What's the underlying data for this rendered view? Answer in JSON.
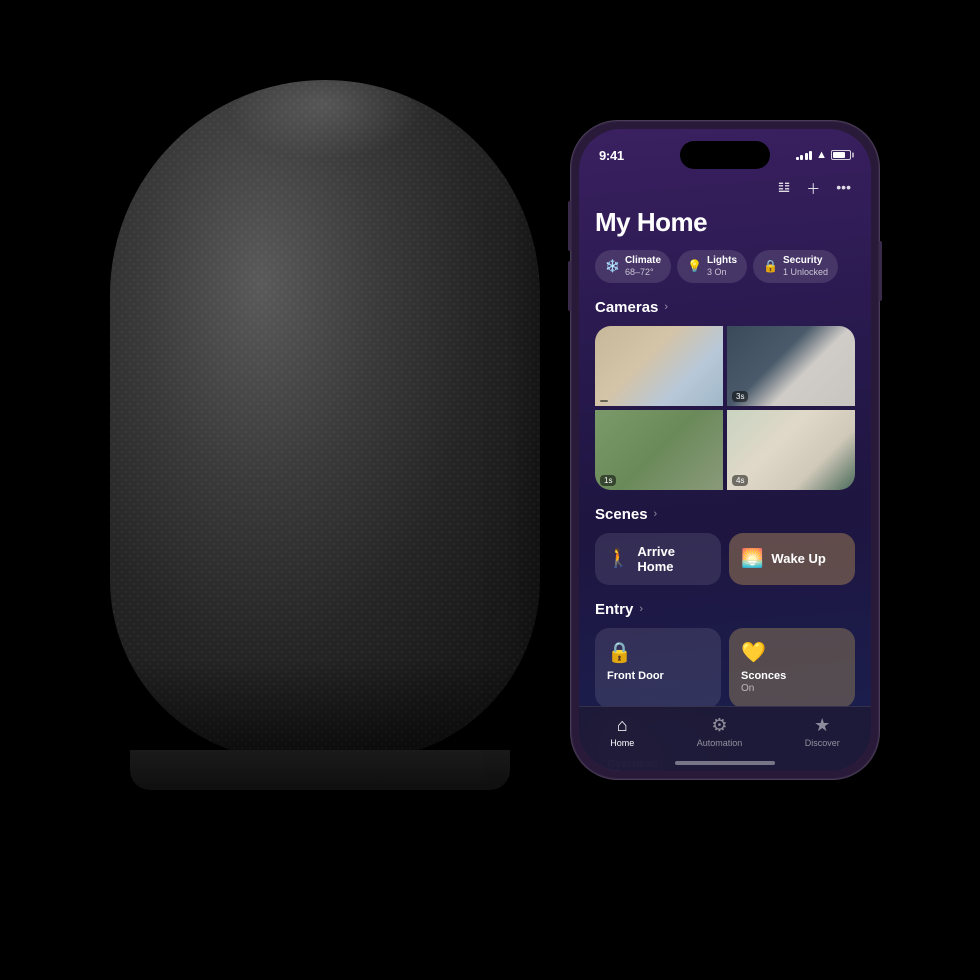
{
  "app": {
    "title": "My Home"
  },
  "status_bar": {
    "time": "9:41",
    "signal_bars": [
      3,
      5,
      7,
      9,
      11
    ],
    "battery_level": "65%"
  },
  "header": {
    "title": "My Home",
    "actions": [
      "waveform-icon",
      "plus-icon",
      "ellipsis-icon"
    ]
  },
  "chips": [
    {
      "icon": "❄️",
      "label": "Climate",
      "sub": "68–72°"
    },
    {
      "icon": "💡",
      "label": "Lights",
      "sub": "3 On"
    },
    {
      "icon": "🔒",
      "label": "Security",
      "sub": "1 Unlocked"
    }
  ],
  "cameras": {
    "section_title": "Cameras",
    "items": [
      {
        "timestamp": "",
        "is_live": false
      },
      {
        "timestamp": "3s",
        "is_live": false
      },
      {
        "timestamp": "1s",
        "is_live": false
      },
      {
        "timestamp": "4s",
        "is_live": false
      }
    ]
  },
  "scenes": {
    "section_title": "Scenes",
    "items": [
      {
        "icon": "🚶",
        "label": "Arrive Home",
        "style": "arrive"
      },
      {
        "icon": "🌅",
        "label": "Wake Up",
        "style": "wakeup"
      }
    ]
  },
  "entry": {
    "section_title": "Entry",
    "items": [
      {
        "icon": "🔒",
        "label": "Front Door",
        "sub": "",
        "on": false
      },
      {
        "icon": "💛",
        "label": "Sconces",
        "sub": "On",
        "on": true
      },
      {
        "icon": "💡",
        "label": "Overhead",
        "sub": "",
        "on": false
      }
    ]
  },
  "tab_bar": {
    "items": [
      {
        "icon": "⌂",
        "label": "Home",
        "active": true
      },
      {
        "icon": "⚙",
        "label": "Automation",
        "active": false
      },
      {
        "icon": "★",
        "label": "Discover",
        "active": false
      }
    ]
  }
}
